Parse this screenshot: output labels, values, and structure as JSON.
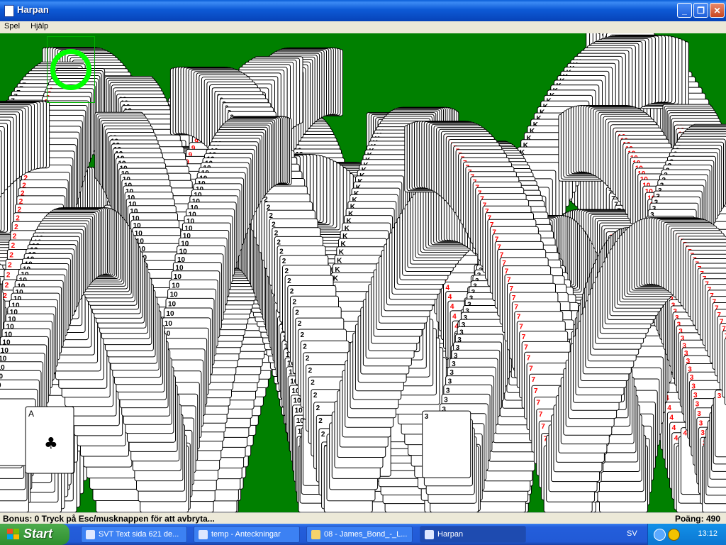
{
  "window": {
    "title": "Harpan",
    "minimize_glyph": "_",
    "maximize_glyph": "❐",
    "close_glyph": "✕"
  },
  "menu": [
    "Spel",
    "Hjälp"
  ],
  "status": {
    "left": "Bonus: 0  Tryck på Esc/musknappen för att avbryta...",
    "right": "Poäng: 490"
  },
  "visible_card_ranks": [
    "K",
    "7",
    "A",
    "3",
    "4",
    "2",
    "9",
    "10"
  ],
  "taskbar": {
    "start_label": "Start",
    "tasks": [
      {
        "label": "SVT Text sida 621 de...",
        "icon": "ie-icon"
      },
      {
        "label": "temp - Anteckningar",
        "icon": "notepad-icon"
      },
      {
        "label": "08 - James_Bond_-_L...",
        "icon": "folder-icon"
      },
      {
        "label": "Harpan",
        "icon": "solitaire-icon"
      }
    ],
    "language": "SV",
    "clock": "13:12"
  },
  "colors": {
    "felt": "#008000",
    "foundation_ring": "#00ff00",
    "card_red": "#ff0000",
    "card_black": "#000000"
  }
}
